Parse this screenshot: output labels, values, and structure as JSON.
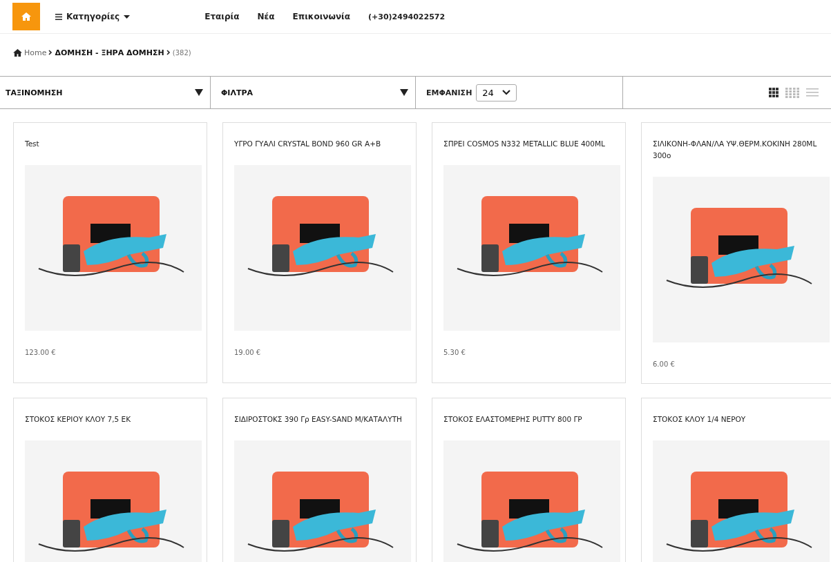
{
  "nav": {
    "categories": "Κατηγορίες",
    "links": [
      "Εταιρία",
      "Νέα",
      "Επικοινωνία"
    ],
    "phone": "(+30)2494022572"
  },
  "breadcrumb": {
    "home": "Home",
    "category": "ΔΟΜΗΣΗ - ΞΗΡΑ ΔΟΜΗΣΗ",
    "count": "(382)"
  },
  "toolbar": {
    "sort": "ΤΑΞΙΝΟΜΗΣΗ",
    "filters": "ΦΙΛΤΡΑ",
    "show_label": "ΕΜΦΑΝΙΣΗ",
    "per_page": "24",
    "views": [
      {
        "kind": "grid3",
        "selected": true
      },
      {
        "kind": "grid4",
        "selected": false
      },
      {
        "kind": "list",
        "selected": false
      }
    ]
  },
  "products": [
    {
      "title": "Test",
      "price": "123.00 €"
    },
    {
      "title": "ΥΓΡΟ ΓΥΑΛΙ CRYSTAL BOND 960 GR A+B",
      "price": "19.00 €"
    },
    {
      "title": "ΣΠΡΕΙ COSMOS N332 METALLIC BLUE 400ML",
      "price": "5.30 €"
    },
    {
      "title": "ΣΙΛΙΚΟΝΗ-ΦΛΑΝ/ΛΑ ΥΨ.ΘΕΡΜ.ΚΟΚΙΝΗ 280ML 300o",
      "price": "6.00 €"
    },
    {
      "title": "ΣΤΟΚΟΣ ΚΕΡΙΟΥ ΚΛΟΥ 7,5 ΕΚ"
    },
    {
      "title": "ΣΙΔΙΡΟΣΤΟΚΣ 390 Γρ EASY-SAND Μ/ΚΑΤΑΛΥΤΗ"
    },
    {
      "title": "ΣΤΟΚΟΣ ΕΛΑΣΤΟΜΕΡΗΣ PUTTY 800 ΓΡ"
    },
    {
      "title": "ΣΤΟΚΟΣ ΚΛΟΥ 1/4 ΝΕΡΟΥ"
    }
  ]
}
